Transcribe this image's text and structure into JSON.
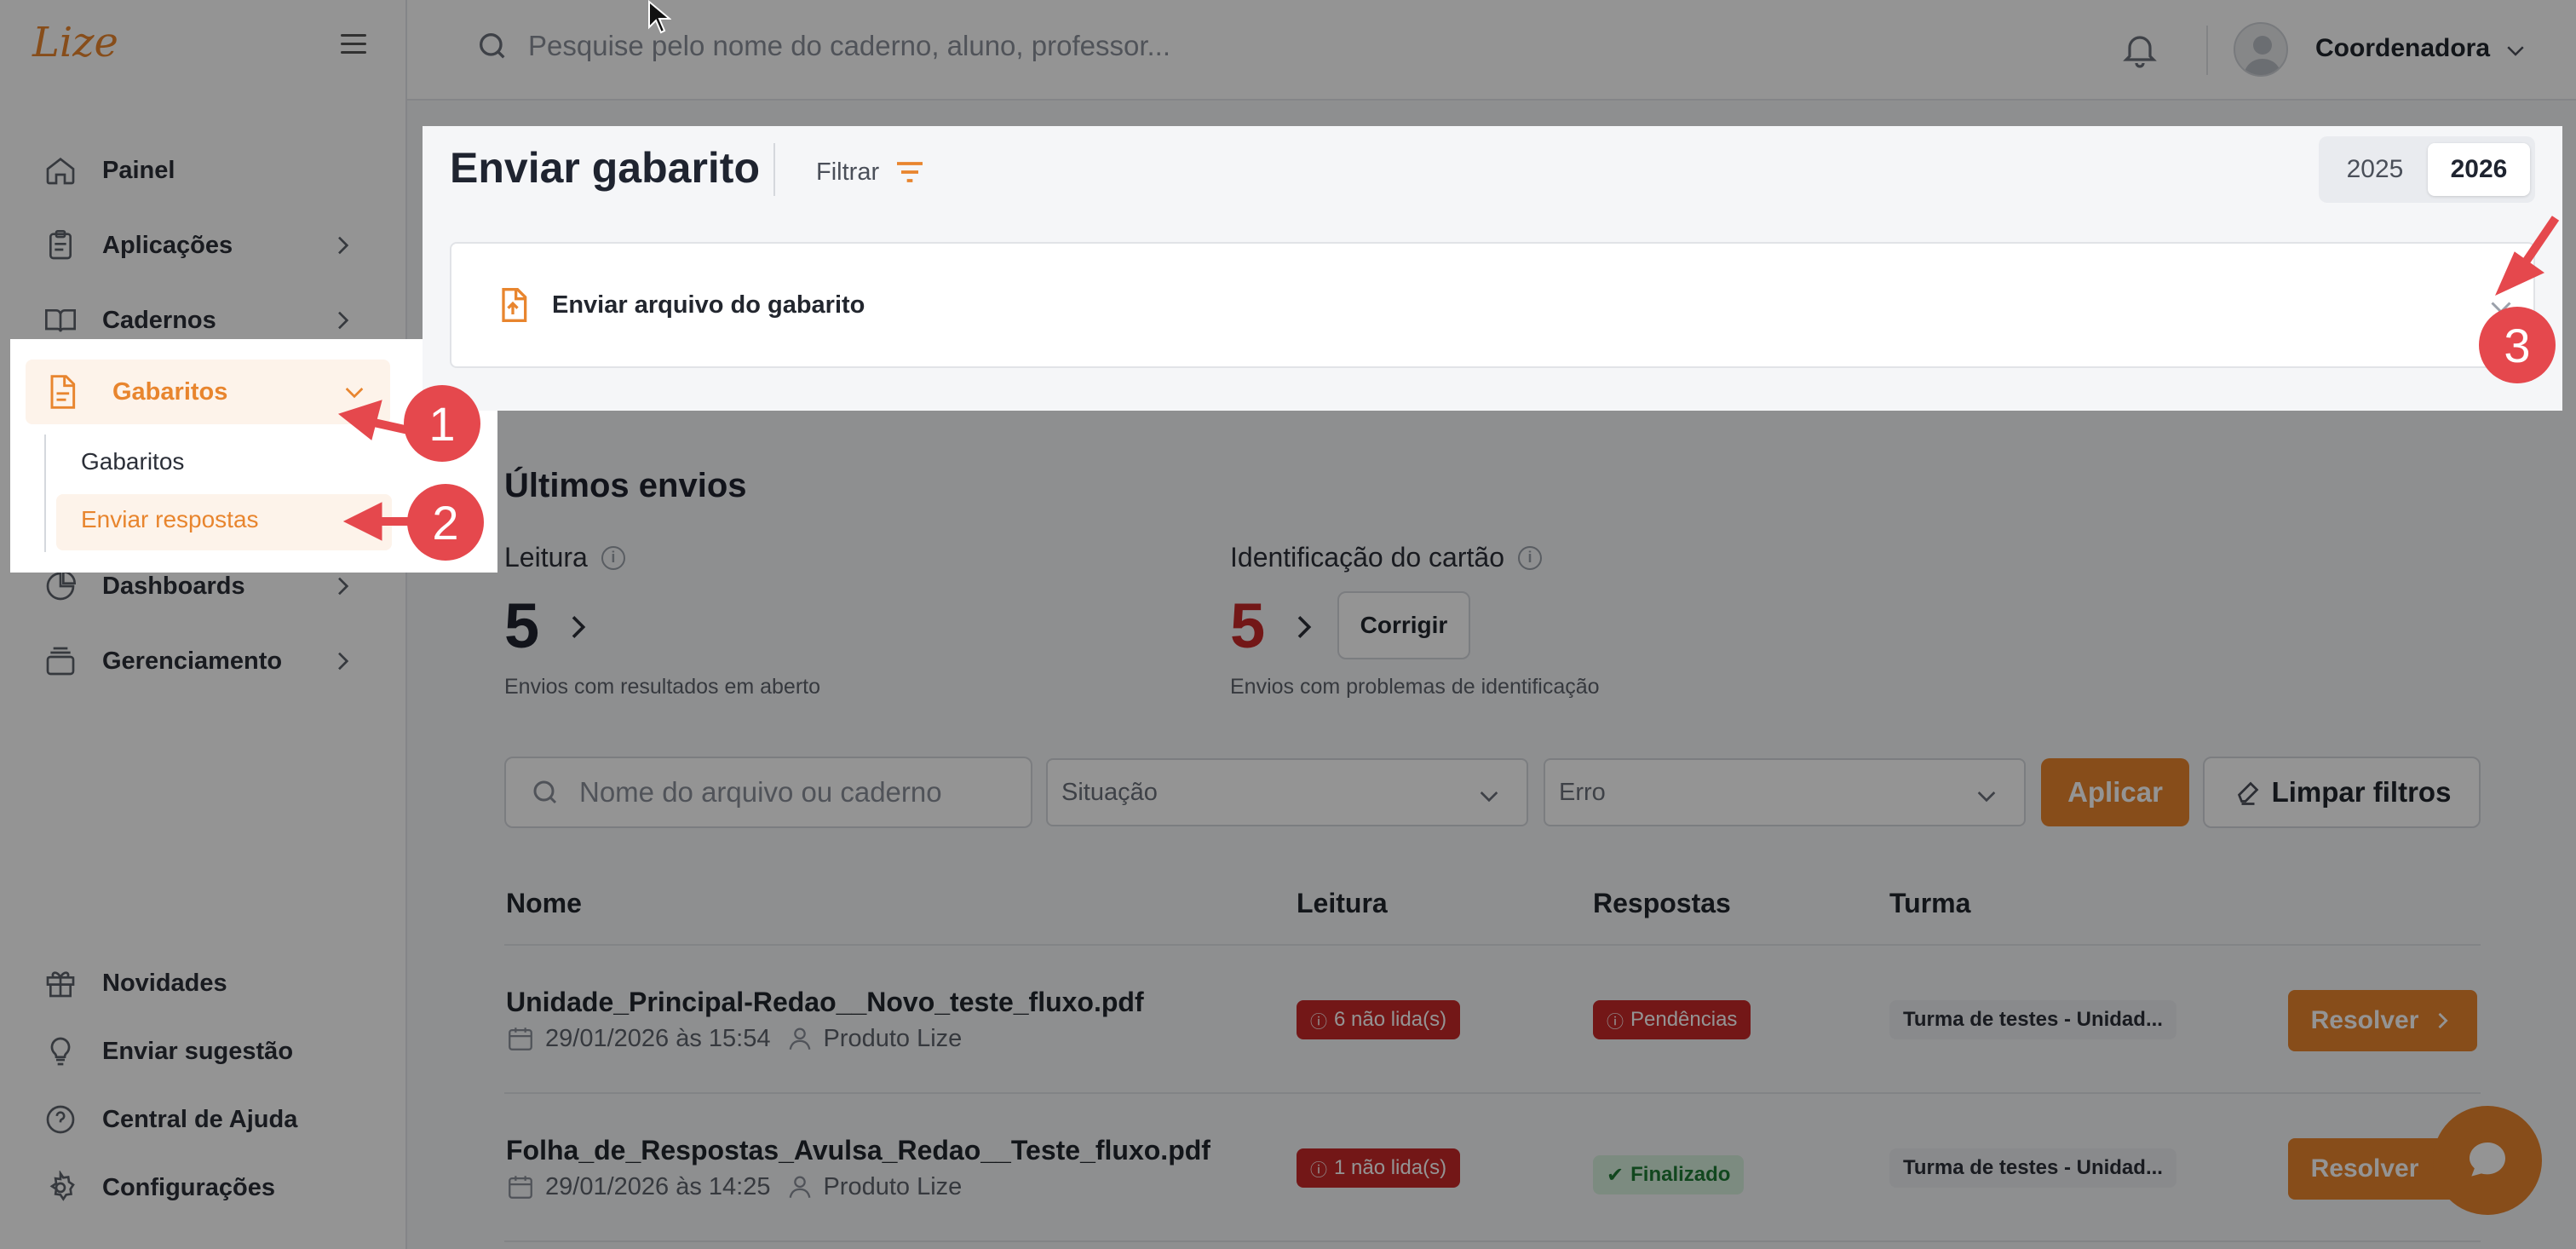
{
  "app": {
    "logo": "Lize"
  },
  "topbar": {
    "search_placeholder": "Pesquise pelo nome do caderno, aluno, professor...",
    "user_name": "Coordenadora"
  },
  "sidebar": {
    "items": [
      {
        "label": "Painel",
        "icon": "home-icon"
      },
      {
        "label": "Aplicações",
        "icon": "clipboard-icon"
      },
      {
        "label": "Cadernos",
        "icon": "book-icon"
      },
      {
        "label": "Gabaritos",
        "icon": "document-icon"
      },
      {
        "label": "Dashboards",
        "icon": "pie-chart-icon"
      },
      {
        "label": "Gerenciamento",
        "icon": "layers-icon"
      }
    ],
    "subitems": [
      {
        "label": "Gabaritos"
      },
      {
        "label": "Enviar respostas"
      }
    ],
    "footer": [
      {
        "label": "Novidades",
        "icon": "gift-icon"
      },
      {
        "label": "Enviar sugestão",
        "icon": "lightbulb-icon"
      },
      {
        "label": "Central de Ajuda",
        "icon": "help-icon"
      },
      {
        "label": "Configurações",
        "icon": "gear-icon"
      }
    ]
  },
  "header": {
    "title": "Enviar gabarito",
    "filter_label": "Filtrar",
    "years": [
      "2025",
      "2026"
    ],
    "selected_year": "2026",
    "upload_label": "Enviar arquivo do gabarito"
  },
  "recent": {
    "title": "Últimos envios",
    "reading": {
      "label": "Leitura",
      "value": "5",
      "subtitle": "Envios com resultados em aberto"
    },
    "identification": {
      "label": "Identificação do cartão",
      "value": "5",
      "subtitle": "Envios com problemas de identificação",
      "action": "Corrigir"
    }
  },
  "filters": {
    "search_placeholder": "Nome do arquivo ou caderno",
    "status_placeholder": "Situação",
    "error_placeholder": "Erro",
    "apply": "Aplicar",
    "clear": "Limpar filtros"
  },
  "table": {
    "columns": [
      "Nome",
      "Leitura",
      "Respostas",
      "Turma"
    ],
    "rows": [
      {
        "name": "Unidade_Principal-Redao__Novo_teste_fluxo.pdf",
        "date": "29/01/2026 às 15:54",
        "author": "Produto Lize",
        "reading": "6 não lida(s)",
        "answers": "Pendências",
        "class": "Turma de testes - Unidad...",
        "action": "Resolver"
      },
      {
        "name": "Folha_de_Respostas_Avulsa_Redao__Teste_fluxo.pdf",
        "date": "29/01/2026 às 14:25",
        "author": "Produto Lize",
        "reading": "1 não lida(s)",
        "answers": "Finalizado",
        "class": "Turma de testes - Unidad...",
        "action": "Resolver"
      }
    ]
  },
  "annotations": {
    "markers": [
      "1",
      "2",
      "3"
    ]
  },
  "colors": {
    "accent": "#e8852e",
    "danger": "#c62828",
    "success": "#1e7a35",
    "marker": "#e5484d"
  }
}
